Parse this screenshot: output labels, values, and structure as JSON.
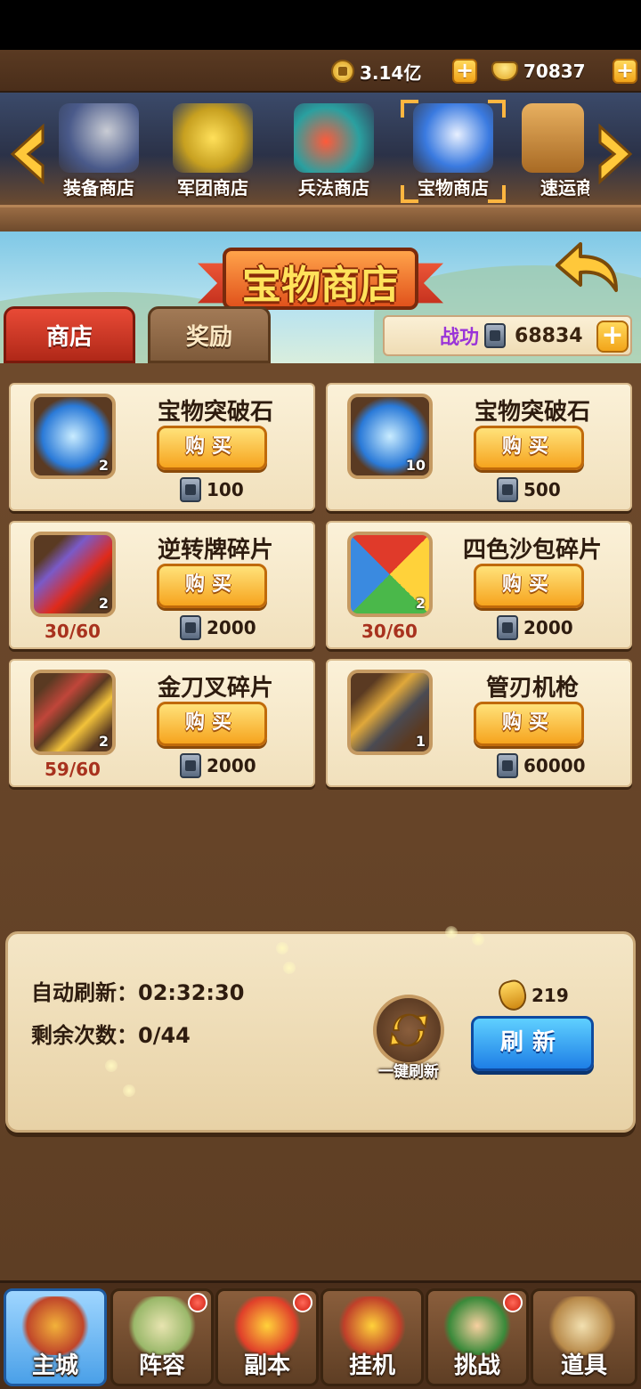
{
  "resources": {
    "coins": "3.14亿",
    "ingots": "70837"
  },
  "shop_tabs": [
    {
      "label": "装备商店",
      "icon": "armor-helmet-icon"
    },
    {
      "label": "军团商店",
      "icon": "gold-ingot-pile-icon"
    },
    {
      "label": "兵法商店",
      "icon": "gem-scroll-icon"
    },
    {
      "label": "宝物商店",
      "icon": "treasure-token-icon",
      "selected": true
    },
    {
      "label": "速运商",
      "icon": "crate-icon"
    }
  ],
  "banner": {
    "title": "宝物商店"
  },
  "sub_tabs": {
    "shop": "商店",
    "reward": "奖励"
  },
  "merit": {
    "label": "战功",
    "value": "68834"
  },
  "buy_label": "购买",
  "items": [
    {
      "name": "宝物突破石",
      "qty": "2",
      "price": "100",
      "progress": "",
      "icon": "blue-stone-icon"
    },
    {
      "name": "宝物突破石",
      "qty": "10",
      "price": "500",
      "progress": "",
      "icon": "blue-stone-icon"
    },
    {
      "name": "逆转牌碎片",
      "qty": "2",
      "price": "2000",
      "progress": "30/60",
      "icon": "cards-fragment-icon"
    },
    {
      "name": "四色沙包碎片",
      "qty": "2",
      "price": "2000",
      "progress": "30/60",
      "icon": "sandbag-icon"
    },
    {
      "name": "金刀叉碎片",
      "qty": "2",
      "price": "2000",
      "progress": "59/60",
      "icon": "knife-fork-icon"
    },
    {
      "name": "管刃机枪",
      "qty": "1",
      "price": "60000",
      "progress": "",
      "icon": "gatling-gun-icon"
    }
  ],
  "refresh": {
    "auto_label": "自动刷新：",
    "auto_time": "02:32:30",
    "remaining_label": "剩余次数：",
    "remaining_value": "0/44",
    "one_key_label": "一键刷新",
    "cost": "219",
    "button_label": "刷新"
  },
  "bottom_nav": [
    {
      "label": "主城",
      "icon": "city-gate-icon",
      "active": true,
      "badge": false
    },
    {
      "label": "阵容",
      "icon": "lineup-fan-icon",
      "active": false,
      "badge": true
    },
    {
      "label": "副本",
      "icon": "dungeon-lantern-icon",
      "active": false,
      "badge": true
    },
    {
      "label": "挂机",
      "icon": "idle-bag-icon",
      "active": false,
      "badge": false
    },
    {
      "label": "挑战",
      "icon": "challenge-duel-icon",
      "active": false,
      "badge": true
    },
    {
      "label": "道具",
      "icon": "items-scroll-icon",
      "active": false,
      "badge": false
    }
  ]
}
